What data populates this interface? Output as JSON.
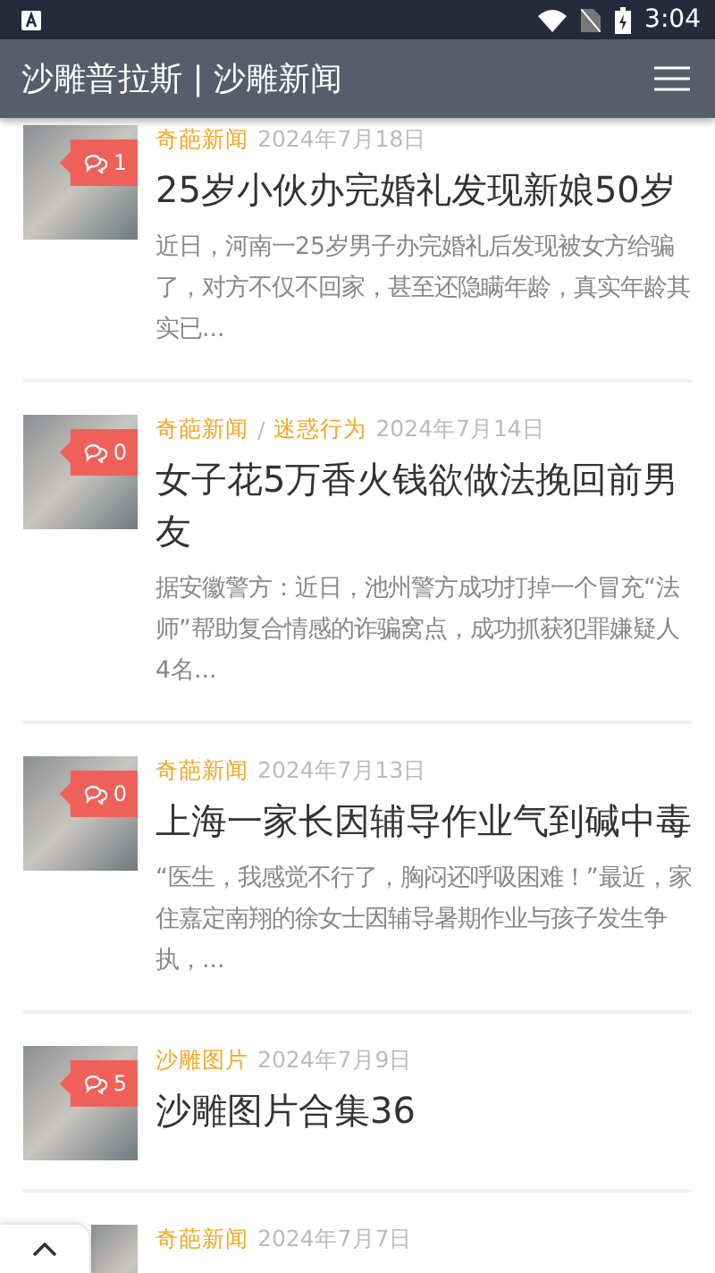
{
  "status_bar": {
    "time": "3:04"
  },
  "app_bar": {
    "title": "沙雕普拉斯 | 沙雕新闻"
  },
  "category_separator": "/",
  "articles": [
    {
      "categories": [
        "奇葩新闻"
      ],
      "date": "2024年7月18日",
      "title": "25岁小伙办完婚礼发现新娘50岁",
      "summary": "近日，河南一25岁男子办完婚礼后发现被女方给骗了，对方不仅不回家，甚至还隐瞒年龄，真实年龄其实已...",
      "comments": "1"
    },
    {
      "categories": [
        "奇葩新闻",
        "迷惑行为"
      ],
      "date": "2024年7月14日",
      "title": "女子花5万香火钱欲做法挽回前男友",
      "summary": "据安徽警方：近日，池州警方成功打掉一个冒充“法师”帮助复合情感的诈骗窝点，成功抓获犯罪嫌疑人4名...",
      "comments": "0"
    },
    {
      "categories": [
        "奇葩新闻"
      ],
      "date": "2024年7月13日",
      "title": "上海一家长因辅导作业气到碱中毒",
      "summary": "“医生，我感觉不行了，胸闷还呼吸困难！”最近，家住嘉定南翔的徐女士因辅导暑期作业与孩子发生争执，...",
      "comments": "0"
    },
    {
      "categories": [
        "沙雕图片"
      ],
      "date": "2024年7月9日",
      "title": "沙雕图片合集36",
      "comments": "5"
    },
    {
      "categories": [
        "奇葩新闻"
      ],
      "date": "2024年7月7日"
    }
  ]
}
